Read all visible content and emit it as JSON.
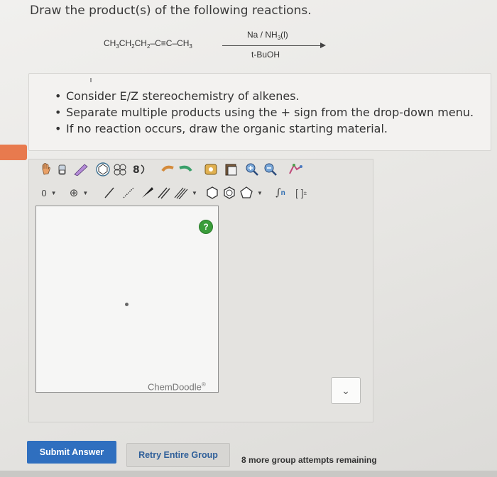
{
  "question": "Draw the product(s) of the following reactions.",
  "reaction": {
    "reactant_parts": [
      "CH",
      "3",
      "CH",
      "2",
      "CH",
      "2",
      "–C≡C–CH",
      "3"
    ],
    "reagent_top_parts": [
      "Na / NH",
      "3",
      "(l)"
    ],
    "reagent_bottom": "t-BuOH"
  },
  "instructions": [
    "Consider E/Z stereochemistry of alkenes.",
    "Separate multiple products using the + sign from the drop-down menu.",
    "If no reaction occurs, draw the organic starting material."
  ],
  "editor": {
    "charge_value": "0",
    "help_label": "?",
    "watermark": "ChemDoodle",
    "watermark_sup": "®",
    "toolbar_row1_icons": [
      "hand-icon",
      "eraser-icon",
      "brush-icon",
      "ring-template-icon",
      "fused-ring-template-icon",
      "arrow-templates-icon",
      "undo-icon",
      "redo-icon",
      "copy-icon",
      "paste-icon",
      "zoom-in-icon",
      "zoom-out-icon",
      "clean-icon"
    ],
    "toolbar_row2_icons": [
      "charge-dropdown",
      "add-atom-icon",
      "single-bond-icon",
      "hashed-bond-icon",
      "wedge-bond-icon",
      "double-bond-icon",
      "triple-bond-icon",
      "bond-dropdown",
      "cyclohexane-icon",
      "benzene-icon",
      "cyclopentane-icon",
      "ring-dropdown",
      "sn-icon",
      "bracket-icon"
    ]
  },
  "dropdown": {
    "chevron": "⌄"
  },
  "buttons": {
    "submit": "Submit Answer",
    "retry": "Retry Entire Group"
  },
  "attempts_text": "8 more group attempts remaining",
  "colors": {
    "accent_blue": "#2f6fbf",
    "help_green": "#3a9d3a",
    "orange_tab": "#e87a4e"
  }
}
